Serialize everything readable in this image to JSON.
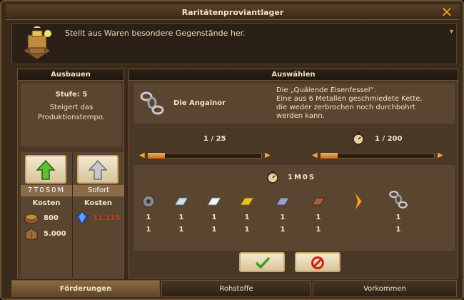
{
  "window": {
    "title": "Raritätenproviantlager"
  },
  "info": {
    "text": "Stellt aus Waren besondere Gegenstände her."
  },
  "left_panel": {
    "header": "Ausbauen",
    "level": "Stufe: 5",
    "description_line1": "Steigert das",
    "description_line2": "Produktionstempo.",
    "upgrade": {
      "time": "7T0S0M",
      "costs_label": "Kosten",
      "costs": [
        {
          "icon": "coin-icon",
          "value": "800"
        },
        {
          "icon": "supplies-icon",
          "value": "5.000"
        }
      ]
    },
    "instant": {
      "label": "Sofort",
      "costs_label": "Kosten",
      "cost": {
        "icon": "diamond-icon",
        "value": "11.115",
        "color": "#e03020"
      }
    }
  },
  "right_panel": {
    "header": "Auswählen",
    "item": {
      "name": "Die Angainor",
      "desc1": "Die „Quälende Eisenfessel“.",
      "desc2": "Eine aus 6 Metallen geschmiedete Kette,",
      "desc3": "die weder zerbrochen noch durchbohrt",
      "desc4": "werden kann."
    },
    "quantity": {
      "text": "1 / 25",
      "fraction": 0.04
    },
    "time_slider": {
      "text": "1 / 200",
      "fraction": 0.005
    },
    "duration": "1M0S",
    "inputs": [
      {
        "icon": "gear-metal-icon",
        "n1": "1",
        "n2": "1"
      },
      {
        "icon": "silver-bar-icon",
        "n1": "1",
        "n2": "1"
      },
      {
        "icon": "platinum-bar-icon",
        "n1": "1",
        "n2": "1"
      },
      {
        "icon": "gold-bar-icon",
        "n1": "1",
        "n2": "1"
      },
      {
        "icon": "mithril-bar-icon",
        "n1": "1",
        "n2": "1"
      },
      {
        "icon": "copper-bar-icon",
        "n1": "1",
        "n2": "1"
      }
    ],
    "output": {
      "icon": "chain-icon",
      "n1": "1",
      "n2": "1"
    }
  },
  "tabs": [
    {
      "label": "Förderungen"
    },
    {
      "label": "Rohstoffe"
    },
    {
      "label": "Vorkommen"
    }
  ]
}
